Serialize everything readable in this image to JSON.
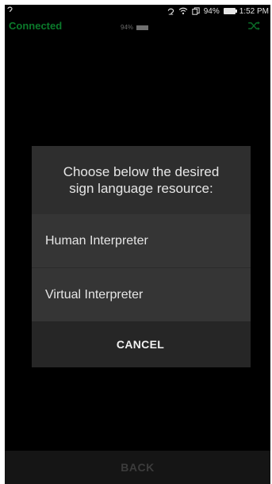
{
  "status_bar": {
    "left_icon": "hearing-aid-icon",
    "icons": [
      "hearing-aid-icon",
      "wifi-icon",
      "copy-icon"
    ],
    "battery_percent": "94%",
    "time": "1:52 PM"
  },
  "app_header": {
    "connection_status": "Connected",
    "connection_color": "#0b7a2b",
    "device_battery_percent": "94%",
    "right_icon": "shuffle-icon"
  },
  "dialog": {
    "title_lines": [
      "Choose below the desired",
      "sign language resource:"
    ],
    "options": [
      "Human Interpreter",
      "Virtual Interpreter"
    ],
    "cancel_label": "CANCEL"
  },
  "footer": {
    "back_label": "BACK"
  }
}
